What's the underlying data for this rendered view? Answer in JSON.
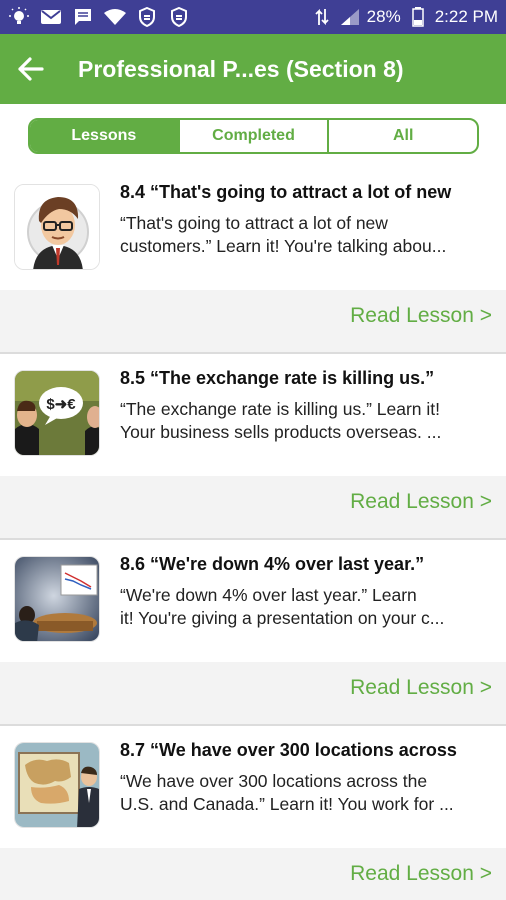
{
  "status_bar": {
    "battery": "28%",
    "time": "2:22 PM",
    "icons": [
      "lightbulb-icon",
      "gmail-icon",
      "message-icon",
      "wifi-icon",
      "vpn-shield-icon",
      "vpn-shield-icon",
      "data-arrows-icon",
      "signal-icon"
    ]
  },
  "app_bar": {
    "title": "Professional P...es (Section 8)",
    "back_icon": "arrow-left-icon",
    "color": "#62ad44"
  },
  "tabs": [
    {
      "label": "Lessons",
      "active": true
    },
    {
      "label": "Completed",
      "active": false
    },
    {
      "label": "All",
      "active": false
    }
  ],
  "lessons": [
    {
      "title": "8.4 “That's going to attract a lot of new",
      "desc_line1": "“That's going to attract a lot of new",
      "desc_line2": "customers.” Learn it! You're talking abou...",
      "link": "Read Lesson >"
    },
    {
      "title": "8.5 “The exchange rate is killing us.”",
      "desc_line1": "“The exchange rate is killing us.” Learn it!",
      "desc_line2": "Your business sells products overseas. ...",
      "thumb_text": "$➜€",
      "link": "Read Lesson >"
    },
    {
      "title": "8.6 “We're down 4% over last year.”",
      "desc_line1": "“We're down 4% over last year.” Learn",
      "desc_line2": "it! You're giving a presentation on your c...",
      "link": "Read Lesson >"
    },
    {
      "title": "8.7 “We have over 300 locations across",
      "desc_line1": "“We have over 300 locations across the",
      "desc_line2": "U.S. and Canada.” Learn it! You work for ...",
      "link": "Read Lesson >"
    }
  ]
}
